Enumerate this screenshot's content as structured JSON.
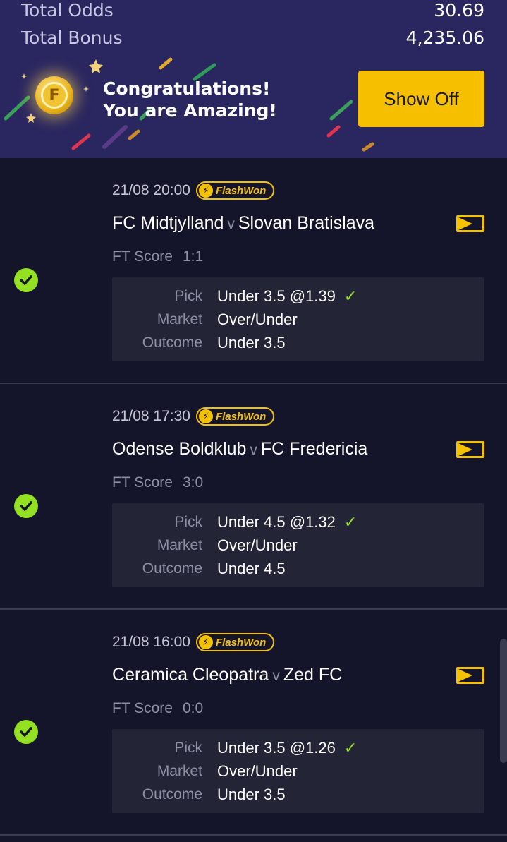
{
  "totals": {
    "odds_label": "Total Odds",
    "odds_value": "30.69",
    "bonus_label": "Total Bonus",
    "bonus_value": "4,235.06"
  },
  "banner": {
    "line1": "Congratulations!",
    "line2": "You are Amazing!",
    "button_label": "Show Off",
    "coin_letter": "F"
  },
  "colors": {
    "header_bg": "#2a2660",
    "page_bg": "#14142a",
    "accent_yellow": "#f6c000",
    "won_green": "#94e023"
  },
  "icons": {
    "won_status": "check-circle-icon",
    "flash": "lightning-icon",
    "live": "live-tracker-icon",
    "pick_result": "checkmark-icon"
  },
  "bets": [
    {
      "datetime": "21/08 20:00",
      "badge": "FlashWon",
      "home": "FC Midtjylland",
      "separator": "v",
      "away": "Slovan Bratislava",
      "score_label": "FT Score",
      "score": "1:1",
      "pick_label": "Pick",
      "pick": "Under 3.5 @1.39",
      "market_label": "Market",
      "market": "Over/Under",
      "outcome_label": "Outcome",
      "outcome": "Under 3.5"
    },
    {
      "datetime": "21/08 17:30",
      "badge": "FlashWon",
      "home": "Odense Boldklub",
      "separator": "v",
      "away": "FC Fredericia",
      "score_label": "FT Score",
      "score": "3:0",
      "pick_label": "Pick",
      "pick": "Under 4.5 @1.32",
      "market_label": "Market",
      "market": "Over/Under",
      "outcome_label": "Outcome",
      "outcome": "Under 4.5"
    },
    {
      "datetime": "21/08 16:00",
      "badge": "FlashWon",
      "home": "Ceramica Cleopatra",
      "separator": "v",
      "away": "Zed FC",
      "score_label": "FT Score",
      "score": "0:0",
      "pick_label": "Pick",
      "pick": "Under 3.5 @1.26",
      "market_label": "Market",
      "market": "Over/Under",
      "outcome_label": "Outcome",
      "outcome": "Under 3.5"
    }
  ]
}
